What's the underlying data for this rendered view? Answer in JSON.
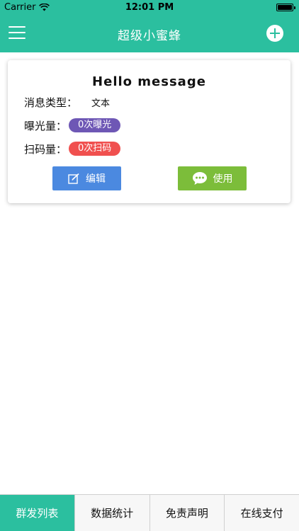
{
  "status_bar": {
    "carrier": "Carrier",
    "time": "12:01 PM",
    "battery_level": 1.0
  },
  "nav": {
    "title": "超级小蜜蜂",
    "menu_icon": "hamburger-menu-icon",
    "add_icon": "plus-circle-icon"
  },
  "card": {
    "title": "Hello message",
    "type_label": "消息类型：",
    "type_value": "文本",
    "exposure_label": "曝光量：",
    "exposure_value": "0次曝光",
    "scan_label": "扫码量：",
    "scan_value": "0次扫码",
    "edit_label": "编辑",
    "use_label": "使用"
  },
  "tabs": [
    {
      "label": "群发列表",
      "active": true
    },
    {
      "label": "数据统计",
      "active": false
    },
    {
      "label": "免责声明",
      "active": false
    },
    {
      "label": "在线支付",
      "active": false
    }
  ],
  "colors": {
    "primary": "#2bbf9f",
    "exposure_pill": "#6e57b5",
    "scan_pill": "#f0504f",
    "edit_button": "#4b89e0",
    "use_button": "#7cbd3a"
  }
}
